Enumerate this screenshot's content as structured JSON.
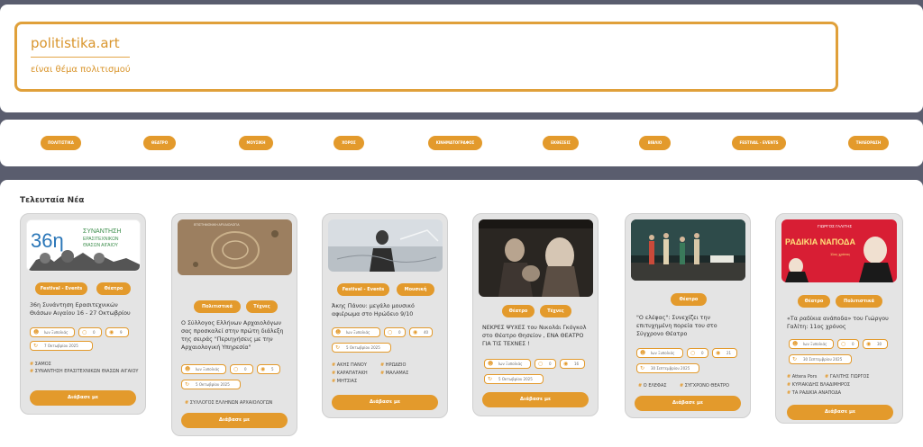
{
  "site": {
    "title": "politistika.art",
    "subtitle": "είναι θέμα πολιτισμού"
  },
  "nav": {
    "items": [
      {
        "label": "ΠΟΛΙΤΙΣΤΙΚΑ"
      },
      {
        "label": "ΘΕΑΤΡΟ"
      },
      {
        "label": "ΜΟΥΣΙΚΗ"
      },
      {
        "label": "ΧΟΡΟΣ"
      },
      {
        "label": "ΚΙΝΗΜΑΤΟΓΡΑΦΟΣ"
      },
      {
        "label": "ΕΚΘΕΣΕΙΣ"
      },
      {
        "label": "ΒΙΒΛΙΟ"
      },
      {
        "label": "FESTIVAL - EVENTS"
      },
      {
        "label": "ΤΗΛΕΟΡΑΣΗ"
      }
    ]
  },
  "section": {
    "title": "Τελευταία Νέα"
  },
  "read_more_label": "Διάβασε με",
  "colors": {
    "accent": "#e39a2c",
    "background": "#5a5d6e"
  },
  "cards": [
    {
      "image_text": {
        "big": "36η",
        "l1": "ΣΥΝΑΝΤΗΣΗ",
        "l2": "ΕΡΑΣΙΤΕΧΝΙΚΩΝ",
        "l3": "ΘΙΑΣΩΝ ΑΙΓΑΙΟΥ"
      },
      "tags": [
        "Festival - Events",
        "Θέατρο"
      ],
      "title": "36η Συνάντηση Ερασιτεχνικών Θιάσων Αιγαίου 16 - 27 Οκτωβρίου",
      "author": "Ιων Ξυπολιάς",
      "comments": "0",
      "views": "9",
      "date": "7 Οκτωβρίου 2025",
      "keywords": [
        "ΣΑΜΟΣ",
        "ΣΥΝΑΝΤΗΣΗ ΕΡΑΣΙΤΕΧΝΙΚΩΝ ΘΙΑΣΩΝ ΑΙΓΑΙΟΥ"
      ]
    },
    {
      "image_text": {
        "caption": "ΕΠΙΣΤΗΜΟΝΙΚΗ ΑΡΧΑΙΟΛΟΓΙΑ"
      },
      "tags": [
        "Πολιτιστικά",
        "Τέχνες"
      ],
      "title": "Ο Σύλλογος Ελλήνων Αρχαιολόγων σας προσκαλεί στην πρώτη διάλεξη της σειράς \"Περιηγήσεις με την Αρχαιολογική Υπηρεσία\"",
      "author": "Ιων Ξυπολιάς",
      "comments": "0",
      "views": "5",
      "date": "5 Οκτωβρίου 2025",
      "keywords": [
        "ΣΥΛΛΟΓΟΣ ΕΛΛΗΝΩΝ ΑΡΧΑΙΟΛΟΓΩΝ"
      ]
    },
    {
      "tags": [
        "Festival - Events",
        "Μουσική"
      ],
      "title": "Άκης Πάνου: μεγάλο μουσικό αφιέρωμα στο Ηρώδειο 9/10",
      "author": "Ιων Ξυπολιάς",
      "comments": "0",
      "views": "40",
      "date": "5 Οκτωβρίου 2025",
      "keywords": [
        "ΑΚΗΣ ΠΑΝΟΥ",
        "ΗΡΩΔΕΙΟ",
        "ΚΑΡΑΠΑΤΑΚΗ",
        "ΜΑΛΑΜΑΣ",
        "ΜΗΤΣΙΑΣ"
      ]
    },
    {
      "tags": [
        "Θέατρο",
        "Τέχνες"
      ],
      "title": "ΝΕΚΡΕΣ ΨΥΧΕΣ του Νικολάι Γκόγκολ στο Θέατρο Θησείον , ΕΝΑ ΘΕΑΤΡΟ ΓΙΑ ΤΙΣ ΤΕΧΝΕΣ !",
      "author": "Ιων Ξυπολιάς",
      "comments": "0",
      "views": "16",
      "date": "5 Οκτωβρίου 2025",
      "keywords": []
    },
    {
      "tags": [
        "Θέατρο"
      ],
      "title": "\"Ο ελέφας\": Συνεχίζει την επιτυχημένη πορεία του στο Σύγχρονο Θέατρο",
      "author": "Ιων Ξυπολιάς",
      "comments": "0",
      "views": "21",
      "date": "30 Σεπτεμβρίου 2025",
      "keywords": [
        "Ο ΕΛΕΦΑΣ",
        "ΣΥΓΧΡΟΝΟ ΘΕΑΤΡΟ"
      ]
    },
    {
      "image_text": {
        "top": "ΓΙΩΡΓΟΣ ΓΑΛΙΤΗΣ",
        "big": "ΡΑΔΙΚΙΑ ΝΑΠΟΔΑ",
        "small": "11ος χρόνος"
      },
      "tags": [
        "Θέατρο",
        "Πολιτιστικά"
      ],
      "title": "«Τα ραδίκια ανάποδα» του Γιώργου Γαλίτη: 11ος χρόνος",
      "author": "Ιων Ξυπολιάς",
      "comments": "0",
      "views": "30",
      "date": "30 Σεπτεμβρίου 2025",
      "keywords": [
        "Attera Pors",
        "ΓΑΛΙΤΗΣ ΓΙΩΡΓΟΣ",
        "ΚΥΡΙΑΚΙΔΗΣ ΒΛΑΔΙΜΗΡΟΣ",
        "ΤΑ ΡΑΔΙΚΙΑ ΑΝΑΠΟΔΑ"
      ]
    }
  ]
}
